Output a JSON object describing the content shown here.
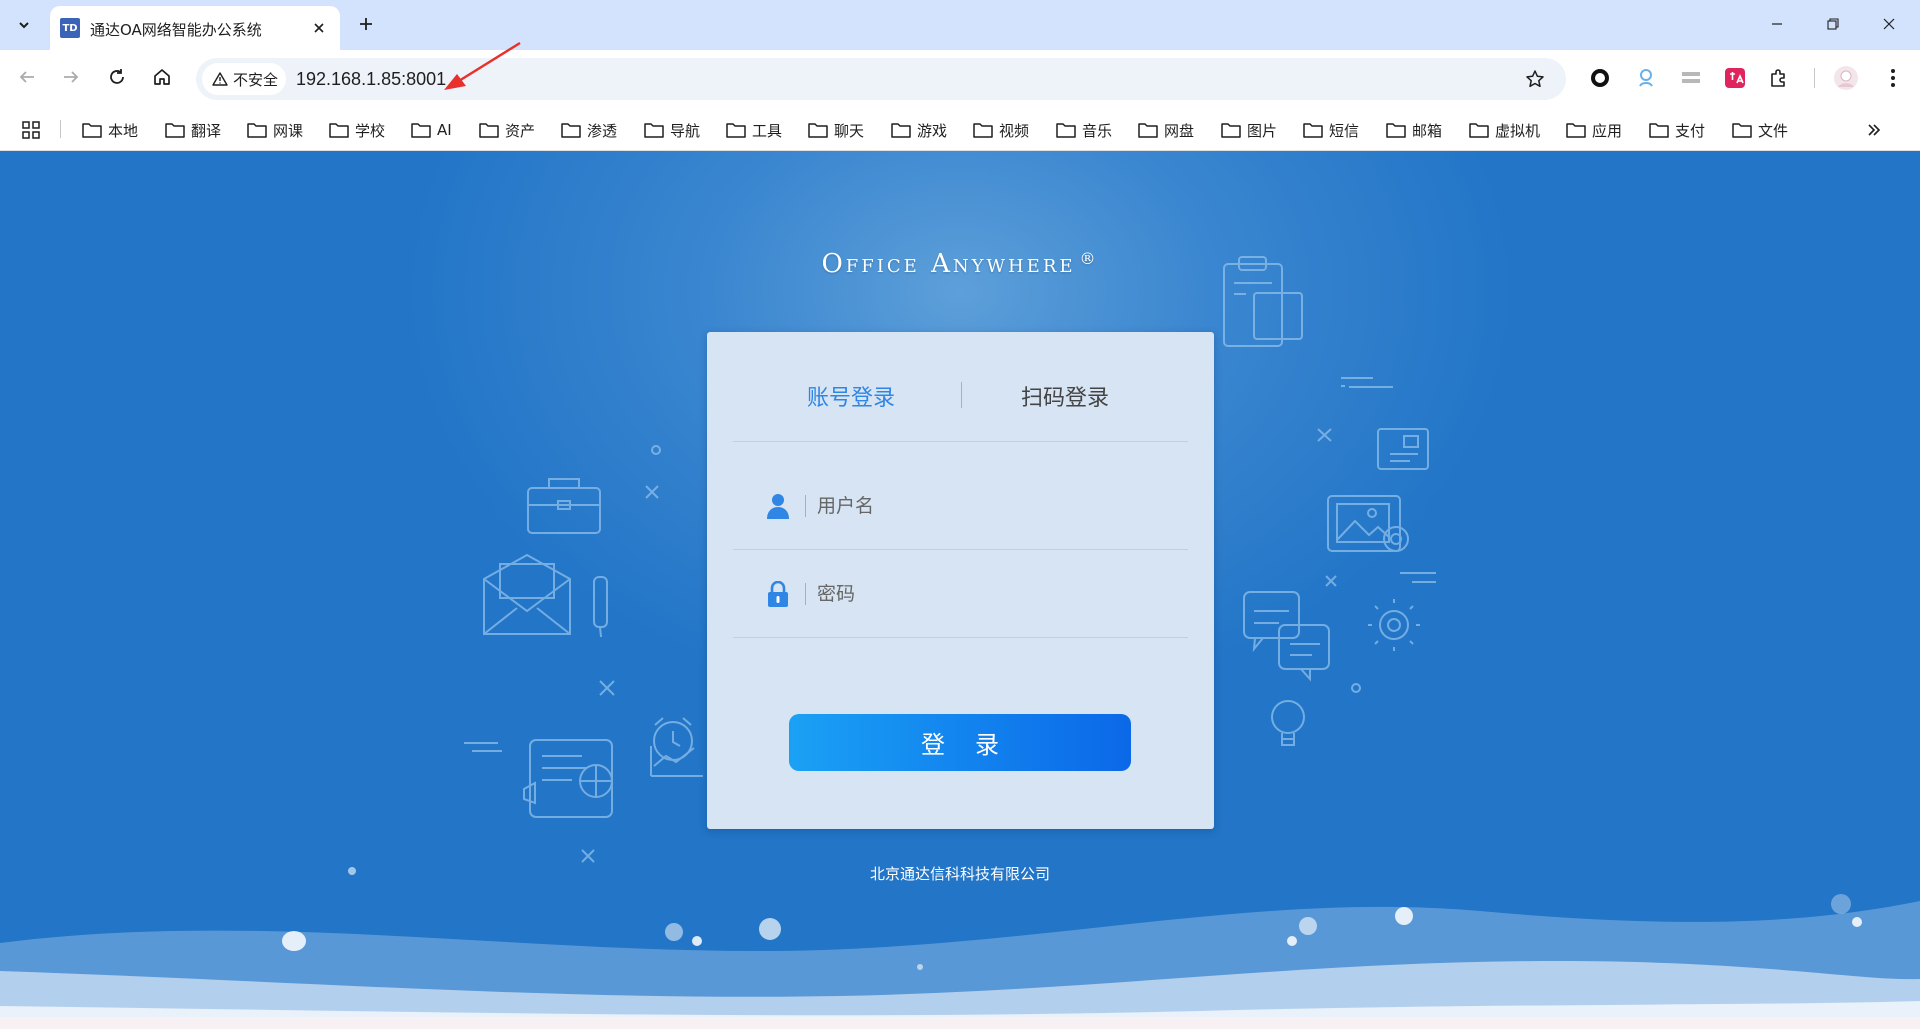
{
  "browser": {
    "tab": {
      "favicon_text": "TD",
      "title": "通达OA网络智能办公系统"
    },
    "address": {
      "security_label": "不安全",
      "url": "192.168.1.85:8001"
    },
    "bookmarks": [
      "本地",
      "翻译",
      "网课",
      "学校",
      "AI",
      "资产",
      "渗透",
      "导航",
      "工具",
      "聊天",
      "游戏",
      "视频",
      "音乐",
      "网盘",
      "图片",
      "短信",
      "邮箱",
      "虚拟机",
      "应用",
      "支付",
      "文件"
    ]
  },
  "page": {
    "brand": "Office Anywhere",
    "brand_mark": "®",
    "login": {
      "tab_account": "账号登录",
      "tab_qr": "扫码登录",
      "username_placeholder": "用户名",
      "password_placeholder": "密码",
      "submit_label": "登录"
    },
    "company": "北京通达信科科技有限公司"
  },
  "colors": {
    "accent": "#2f86e4",
    "background": "#2275c7",
    "button": "#1a8cf0"
  }
}
